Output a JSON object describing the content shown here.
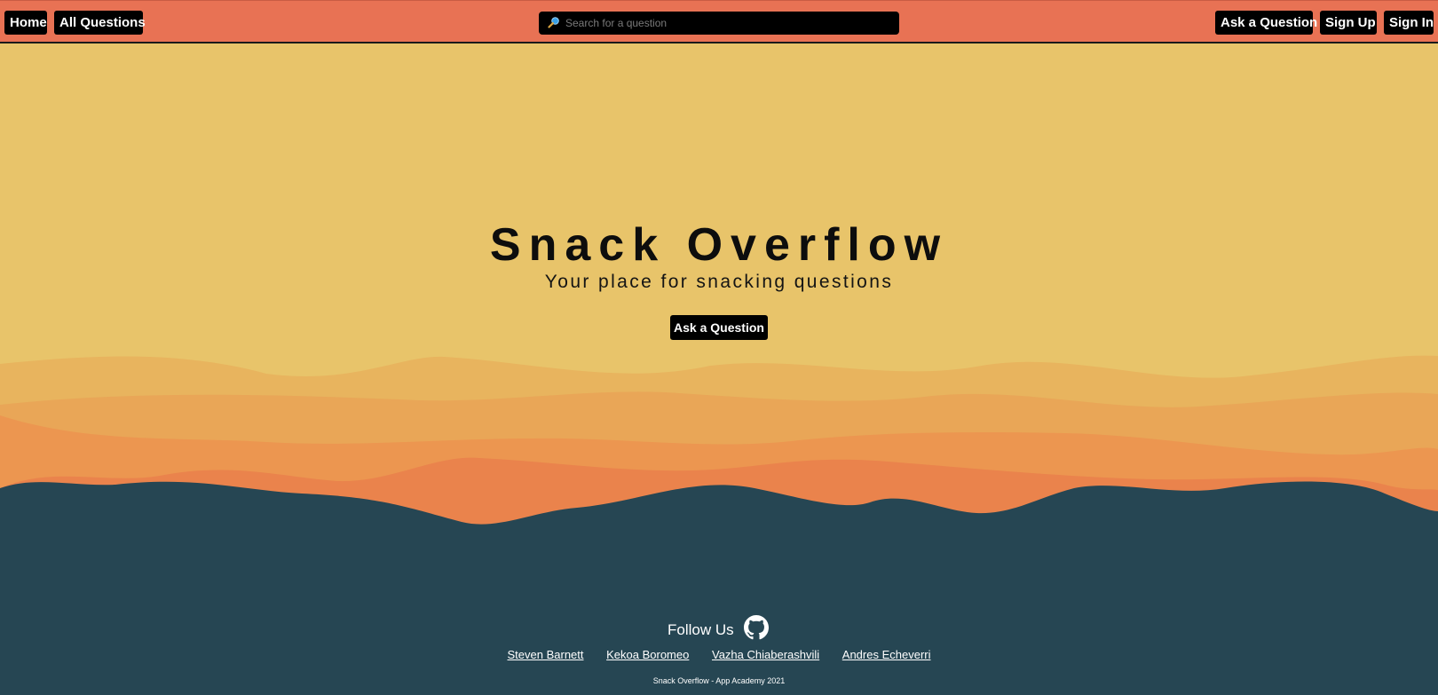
{
  "nav": {
    "home_label": "Home",
    "all_questions_label": "All Questions",
    "ask_label": "Ask a Question",
    "signup_label": "Sign Up",
    "signin_label": "Sign In"
  },
  "search": {
    "placeholder": "Search for a question",
    "value": ""
  },
  "hero": {
    "title": "Snack Overflow",
    "subtitle": "Your place for snacking questions",
    "ask_button": "Ask a Question"
  },
  "footer": {
    "follow_label": "Follow Us",
    "links": [
      "Steven Barnett",
      "Kekoa Boromeo",
      "Vazha Chiaberashvili",
      "Andres Echeverri"
    ],
    "copyright": "Snack Overflow - App Academy 2021"
  },
  "colors": {
    "navbar": "#e87254",
    "hero_bg": "#e8c46a",
    "footer_bg": "#264653",
    "button_bg": "#000000",
    "button_text": "#ffffff"
  },
  "icons": {
    "search": "search-icon",
    "github": "github-icon"
  }
}
